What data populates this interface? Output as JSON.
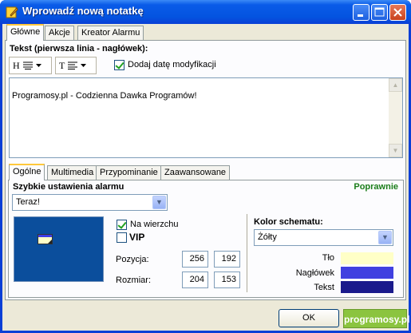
{
  "window": {
    "title": "Wprowadź nową notatkę"
  },
  "main_tabs": [
    {
      "label": "Główne"
    },
    {
      "label": "Akcje"
    },
    {
      "label": "Kreator Alarmu"
    }
  ],
  "text_section": {
    "heading": "Tekst (pierwsza linia - nagłówek):",
    "header_format_letter": "H",
    "text_format_letter": "T",
    "add_date_label": "Dodaj datę modyfikacji",
    "add_date_checked": true,
    "memo_text": "Programosy.pl - Codzienna Dawka Programów!"
  },
  "sub_tabs": [
    {
      "label": "Ogólne"
    },
    {
      "label": "Multimedia"
    },
    {
      "label": "Przypominanie"
    },
    {
      "label": "Zaawansowane"
    }
  ],
  "alarm": {
    "heading": "Szybkie ustawienia alarmu",
    "status": "Poprawnie",
    "status_color": "#1a7d1a",
    "selected": "Teraz!"
  },
  "options": {
    "on_top_label": "Na wierzchu",
    "on_top_checked": true,
    "vip_label": "VIP",
    "vip_checked": false,
    "position_label": "Pozycja:",
    "position_x": "256",
    "position_y": "192",
    "size_label": "Rozmiar:",
    "size_w": "204",
    "size_h": "153"
  },
  "scheme": {
    "heading": "Kolor schematu:",
    "selected": "Żółty",
    "rows": [
      {
        "label": "Tło",
        "color": "#ffffc7"
      },
      {
        "label": "Nagłówek",
        "color": "#4040e0"
      },
      {
        "label": "Tekst",
        "color": "#1a1a8c"
      }
    ]
  },
  "buttons": {
    "ok": "OK"
  },
  "watermark": "programosy.pl",
  "icons": {
    "app": "note-pencil-icon",
    "minimize": "minimize-icon",
    "maximize": "maximize-icon",
    "close": "close-icon"
  }
}
